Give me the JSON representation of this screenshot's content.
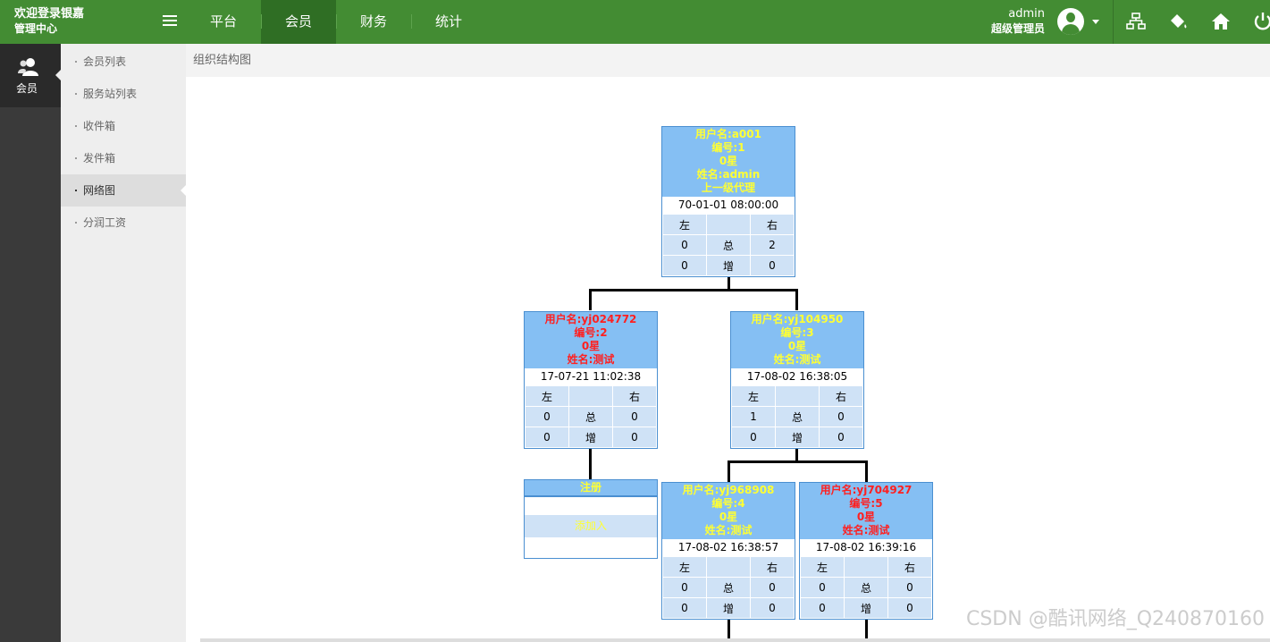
{
  "header": {
    "brand_line1": "欢迎登录银嘉",
    "brand_line2": "管理中心",
    "tabs": [
      {
        "label": "平台",
        "active": false
      },
      {
        "label": "会员",
        "active": true
      },
      {
        "label": "财务",
        "active": false
      },
      {
        "label": "统计",
        "active": false
      }
    ],
    "user_name": "admin",
    "user_role": "超级管理员",
    "icons": [
      "sitemap-icon",
      "paint-bucket-icon",
      "home-icon",
      "power-icon"
    ],
    "accent_color": "#438c33"
  },
  "rail": {
    "label": "会员",
    "icon": "users-icon"
  },
  "submenu": {
    "items": [
      {
        "label": "会员列表",
        "active": false
      },
      {
        "label": "服务站列表",
        "active": false
      },
      {
        "label": "收件箱",
        "active": false
      },
      {
        "label": "发件箱",
        "active": false
      },
      {
        "label": "网络图",
        "active": true
      },
      {
        "label": "分润工资",
        "active": false
      }
    ]
  },
  "main": {
    "breadcrumb": "组织结构图",
    "nodes": {
      "root": {
        "head": [
          "用户名:a001",
          "编号:1",
          "0星",
          "姓名:admin",
          "上一级代理"
        ],
        "date": "70-01-01 08:00:00",
        "rows": [
          [
            "左",
            "",
            "右"
          ],
          [
            "0",
            "总",
            "2"
          ],
          [
            "0",
            "增",
            "0"
          ]
        ]
      },
      "left": {
        "head": [
          "用户名:yj024772",
          "编号:2",
          "0星",
          "姓名:测试"
        ],
        "date": "17-07-21 11:02:38",
        "rows": [
          [
            "左",
            "",
            "右"
          ],
          [
            "0",
            "总",
            "0"
          ],
          [
            "0",
            "增",
            "0"
          ]
        ]
      },
      "right": {
        "head": [
          "用户名:yj104950",
          "编号:3",
          "0星",
          "姓名:测试"
        ],
        "date": "17-08-02 16:38:05",
        "rows": [
          [
            "左",
            "",
            "右"
          ],
          [
            "1",
            "总",
            "0"
          ],
          [
            "0",
            "增",
            "0"
          ]
        ]
      },
      "right_left": {
        "head": [
          "用户名:yj968908",
          "编号:4",
          "0星",
          "姓名:测试"
        ],
        "date": "17-08-02 16:38:57",
        "rows": [
          [
            "左",
            "",
            "右"
          ],
          [
            "0",
            "总",
            "0"
          ],
          [
            "0",
            "增",
            "0"
          ]
        ]
      },
      "right_right": {
        "head": [
          "用户名:yj704927",
          "编号:5",
          "0星",
          "姓名:测试"
        ],
        "date": "17-08-02 16:39:16",
        "rows": [
          [
            "左",
            "",
            "右"
          ],
          [
            "0",
            "总",
            "0"
          ],
          [
            "0",
            "增",
            "0"
          ]
        ]
      },
      "register": {
        "title": "注册",
        "text": "添加入"
      }
    }
  },
  "watermark": "CSDN @酷讯网络_Q240870160"
}
